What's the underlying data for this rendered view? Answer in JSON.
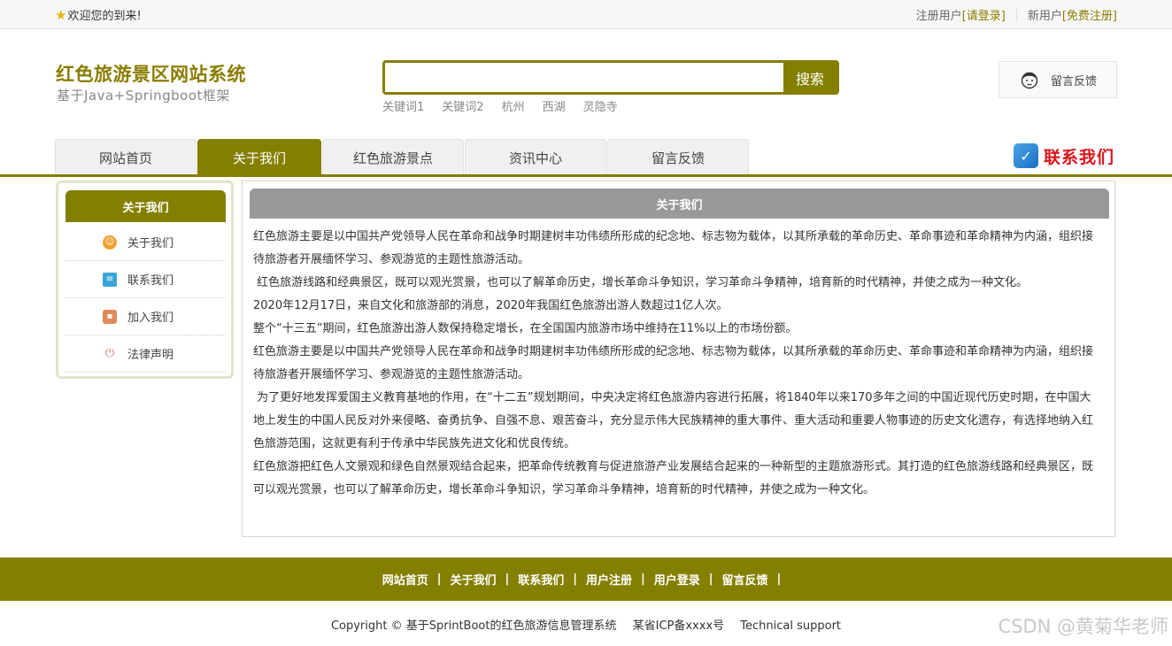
{
  "topbar": {
    "welcome": "欢迎您的到来!",
    "register_user_label": "注册用户",
    "login_link": "[请登录]",
    "new_user_label": "新用户",
    "register_link": "[免费注册]"
  },
  "header": {
    "site_title": "红色旅游景区网站系统",
    "site_subtitle": "基于Java+Springboot框架",
    "search_placeholder": "",
    "search_button": "搜索",
    "hotwords": [
      "关键词1",
      "关键词2",
      "杭州",
      "西湖",
      "灵隐寺"
    ],
    "feedback": "留言反馈"
  },
  "nav": {
    "items": [
      "网站首页",
      "关于我们",
      "红色旅游景点",
      "资讯中心",
      "留言反馈"
    ],
    "active_index": 1,
    "contact": "联系我们"
  },
  "sidebar": {
    "title": "关于我们",
    "items": [
      {
        "label": "关于我们",
        "icon": "smile-icon",
        "color": "#f0a030"
      },
      {
        "label": "联系我们",
        "icon": "clipboard-icon",
        "color": "#3aa6d8"
      },
      {
        "label": "加入我们",
        "icon": "lock-icon",
        "color": "#e08a5a"
      },
      {
        "label": "法律声明",
        "icon": "power-icon",
        "color": "#d0707a"
      }
    ]
  },
  "main": {
    "title": "关于我们",
    "paragraphs": [
      "红色旅游主要是以中国共产党领导人民在革命和战争时期建树丰功伟绩所形成的纪念地、标志物为载体，以其所承载的革命历史、革命事迹和革命精神为内涵，组织接待旅游者开展缅怀学习、参观游览的主题性旅游活动。",
      " 红色旅游线路和经典景区，既可以观光赏景，也可以了解革命历史，增长革命斗争知识，学习革命斗争精神，培育新的时代精神，并使之成为一种文化。",
      "2020年12月17日，来自文化和旅游部的消息，2020年我国红色旅游出游人数超过1亿人次。",
      "整个“十三五”期间，红色旅游出游人数保持稳定增长，在全国国内旅游市场中维持在11%以上的市场份额。",
      "红色旅游主要是以中国共产党领导人民在革命和战争时期建树丰功伟绩所形成的纪念地、标志物为载体，以其所承载的革命历史、革命事迹和革命精神为内涵，组织接待旅游者开展缅怀学习、参观游览的主题性旅游活动。",
      " 为了更好地发挥爱国主义教育基地的作用，在“十二五”规划期间，中央决定将红色旅游内容进行拓展，将1840年以来170多年之间的中国近现代历史时期，在中国大地上发生的中国人民反对外来侵略、奋勇抗争、自强不息、艰苦奋斗，充分显示伟大民族精神的重大事件、重大活动和重要人物事迹的历史文化遗存，有选择地纳入红色旅游范围，这就更有利于传承中华民族先进文化和优良传统。",
      "红色旅游把红色人文景观和绿色自然景观结合起来，把革命传统教育与促进旅游产业发展结合起来的一种新型的主题旅游形式。其打造的红色旅游线路和经典景区，既可以观光赏景，也可以了解革命历史，增长革命斗争知识，学习革命斗争精神，培育新的时代精神，并使之成为一种文化。"
    ]
  },
  "footer": {
    "links": [
      "网站首页",
      "关于我们",
      "联系我们",
      "用户注册",
      "用户登录",
      "留言反馈"
    ],
    "separator": "|",
    "copyright": "Copyright © 基于SprintBoot的红色旅游信息管理系统",
    "icp": "某省ICP备xxxx号",
    "support": "Technical support",
    "watermark": "CSDN @黄菊华老师"
  },
  "colors": {
    "accent": "#857f00",
    "contact_red": "#d9141b"
  }
}
